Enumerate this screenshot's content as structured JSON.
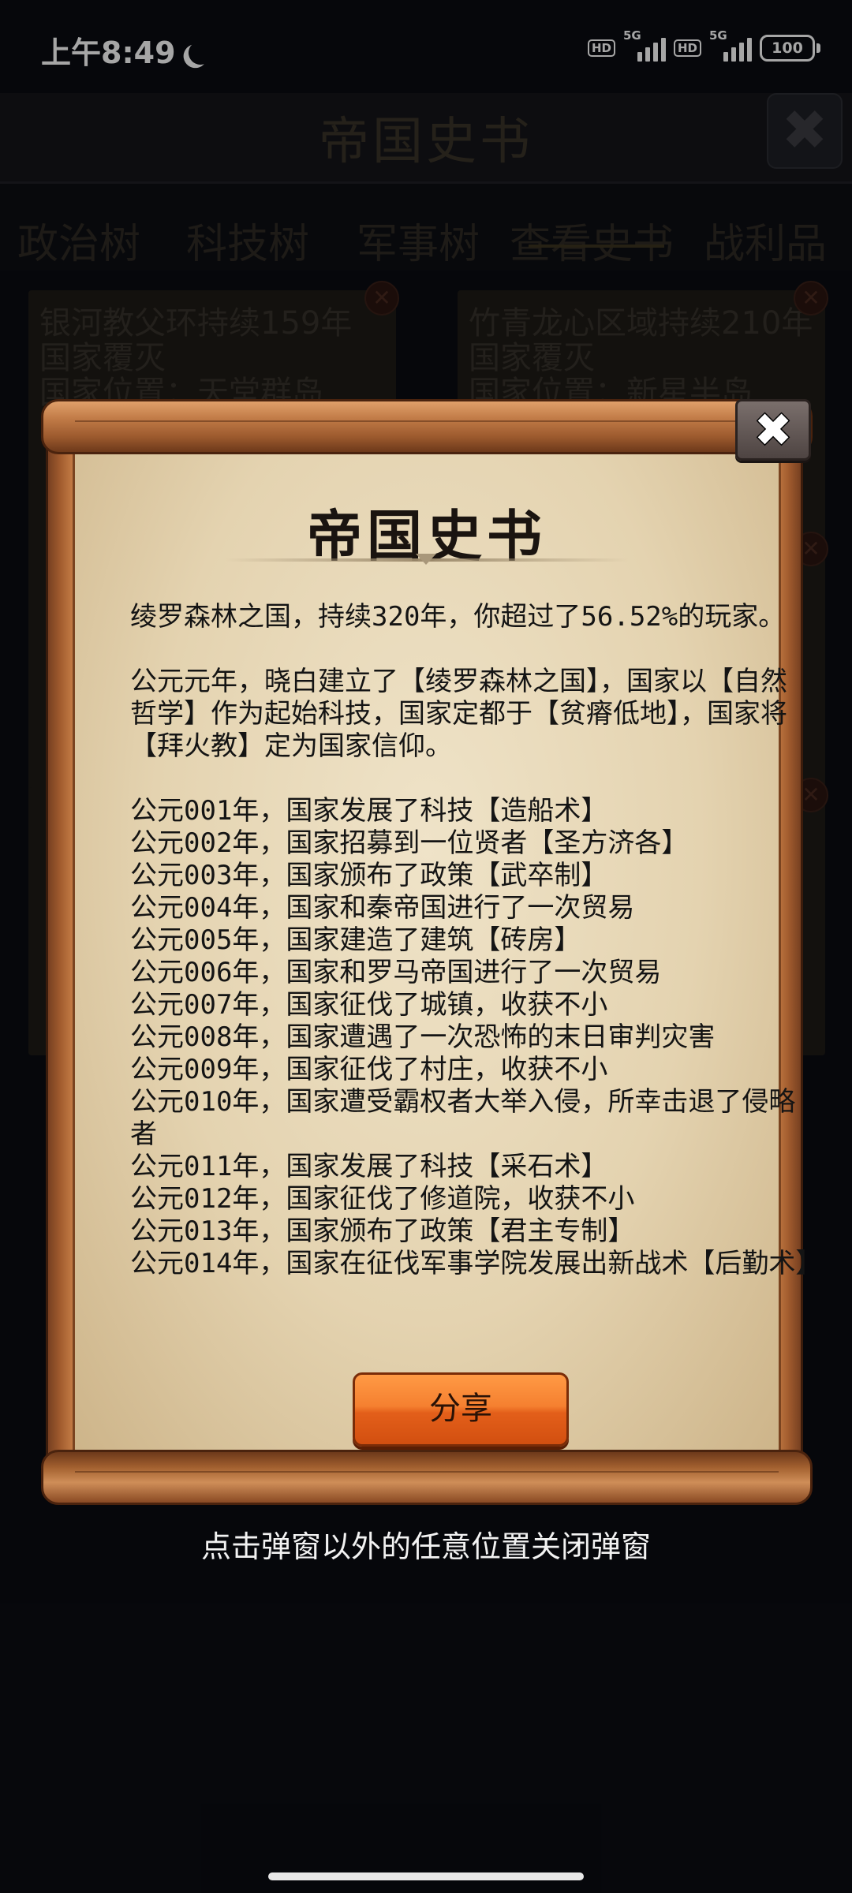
{
  "status_bar": {
    "time": "上午8:49",
    "hd1": "HD",
    "net1": "5G",
    "hd2": "HD",
    "net2": "5G",
    "battery": "100"
  },
  "background": {
    "title": "帝国史书",
    "tabs": [
      "政治树",
      "科技树",
      "军事树",
      "查看史书",
      "战利品"
    ],
    "selected_tab": "查看史书",
    "cards": [
      {
        "line1": "银河教父环持续159年",
        "line2": "国家覆灭",
        "line3": "国家位置：天堂群岛"
      },
      {
        "line1": "竹青龙心区域持续210年",
        "line2": "国家覆灭",
        "line3": "国家位置：新星半岛"
      }
    ]
  },
  "dialog": {
    "title": "帝国史书",
    "close_icon": "close-icon",
    "summary": "绫罗森林之国，持续320年，你超过了56.52%的玩家。",
    "founding": "公元元年，晓白建立了【绫罗森林之国】，国家以【自然哲学】作为起始科技，国家定都于【贫瘠低地】，国家将【拜火教】定为国家信仰。",
    "events": [
      "公元001年，国家发展了科技【造船术】",
      "公元002年，国家招募到一位贤者【圣方济各】",
      "公元003年，国家颁布了政策【武卒制】",
      "公元004年，国家和秦帝国进行了一次贸易",
      "公元005年，国家建造了建筑【砖房】",
      "公元006年，国家和罗马帝国进行了一次贸易",
      "公元007年，国家征伐了城镇，收获不小",
      "公元008年，国家遭遇了一次恐怖的末日审判灾害",
      "公元009年，国家征伐了村庄，收获不小",
      "公元010年，国家遭受霸权者大举入侵，所幸击退了侵略者",
      "公元011年，国家发展了科技【采石术】",
      "公元012年，国家征伐了修道院，收获不小",
      "公元013年，国家颁布了政策【君主专制】",
      "公元014年，国家在征伐军事学院发展出新战术【后勤术】"
    ],
    "share_label": "分享"
  },
  "hint": "点击弹窗以外的任意位置关闭弹窗",
  "colors": {
    "parchment": "#e4d3b0",
    "scroll_wood": "#a35d2f",
    "share_button": "#f58030",
    "background": "#0a0c12"
  }
}
